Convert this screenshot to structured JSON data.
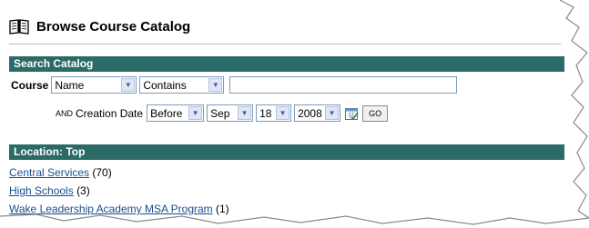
{
  "page": {
    "title": "Browse Course Catalog"
  },
  "search": {
    "section_title": "Search Catalog",
    "course_label": "Course",
    "field_select": "Name",
    "match_select": "Contains",
    "query_value": "",
    "and_word": "AND",
    "date_label": "Creation Date",
    "date_qualifier": "Before",
    "month": "Sep",
    "day": "18",
    "year": "2008",
    "go_label": "GO"
  },
  "location": {
    "section_title": "Location: Top",
    "items": [
      {
        "name": "Central Services",
        "count": "(70)"
      },
      {
        "name": "High Schools",
        "count": "(3)"
      },
      {
        "name": "Wake Leadership Academy MSA Program",
        "count": "(1)"
      }
    ]
  },
  "icons": {
    "title_icon": "open-book-icon",
    "calendar_icon": "calendar-icon",
    "dropdown_icon": "chevron-down-icon"
  },
  "colors": {
    "section_bar": "#2b6b67",
    "link": "#1a4d8f"
  }
}
